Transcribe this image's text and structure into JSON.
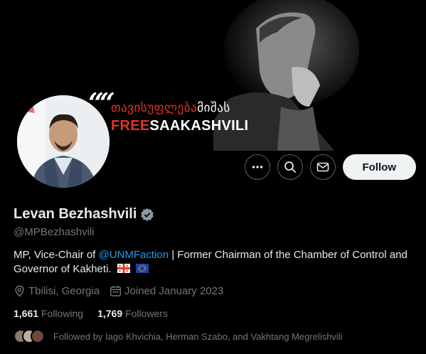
{
  "banner": {
    "quote_mark": "““",
    "geo_prefix": "თავისუფლება",
    "geo_suffix": "მიშას",
    "free_label": "FREE",
    "saakashvili_label": "SAAKASHVILI"
  },
  "actions": {
    "more_icon": "more-icon",
    "search_icon": "search-icon",
    "message_icon": "mail-icon",
    "follow_label": "Follow"
  },
  "profile": {
    "name": "Levan Bezhashvili",
    "verified_icon": "verified-badge-icon",
    "handle": "@MPBezhashvili",
    "bio_prefix": "MP, Vice-Chair of ",
    "bio_mention": "@UNMFaction",
    "bio_suffix": " | Former Chairman of the Chamber of Control and Governor of Kakheti.",
    "location": "Tbilisi, Georgia",
    "joined": "Joined January 2023"
  },
  "stats": {
    "following_count": "1,661",
    "following_label": "Following",
    "followers_count": "1,769",
    "followers_label": "Followers"
  },
  "followed_by": {
    "text": "Followed by Iago Khvichia, Herman Szabo, and Vakhtang Megrelishvili"
  },
  "colors": {
    "accent": "#1d9bf0",
    "background": "#000000",
    "muted": "#71767b",
    "banner_red": "#e0342a"
  }
}
